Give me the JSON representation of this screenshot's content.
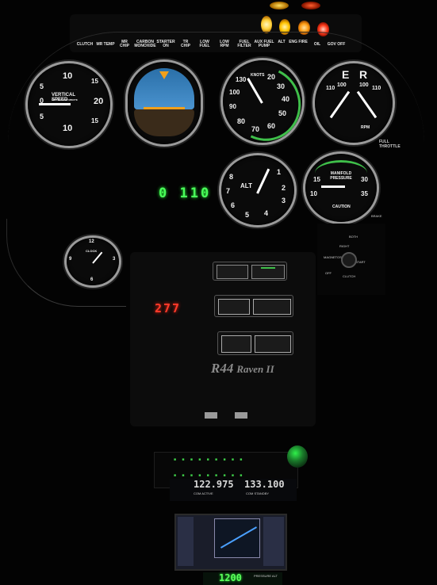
{
  "annunciators": [
    "CLUTCH",
    "MR TEMP",
    "MR CHIP",
    "CARBON MONOXIDE",
    "STARTER ON",
    "TR CHIP",
    "LOW FUEL",
    "LOW RPM",
    "FUEL FILTER",
    "AUX FUEL PUMP",
    "ALT",
    "ENG FIRE",
    "OIL",
    "GOV OFF"
  ],
  "gauges": {
    "vsi": {
      "title": "VERTICAL SPEED",
      "subtitle": "100 FEET PER MINUTE",
      "marks": [
        "10",
        "20",
        "10",
        "5",
        "5",
        "15",
        "15",
        "0"
      ]
    },
    "airspeed": {
      "title": "KNOTS",
      "marks": [
        "20",
        "30",
        "40",
        "50",
        "60",
        "70",
        "80",
        "90",
        "100",
        "130"
      ]
    },
    "tach": {
      "left_label": "E",
      "right_label": "R",
      "marks": [
        "110",
        "100",
        "100",
        "110"
      ],
      "unit": "RPM"
    },
    "altimeter": {
      "title": "ALT",
      "marks": [
        "8",
        "7",
        "6",
        "5",
        "4",
        "3",
        "2",
        "1"
      ]
    },
    "manifold": {
      "title": "MANIFOLD PRESSURE",
      "marks": [
        "15",
        "10",
        "30",
        "35"
      ],
      "caution": "CAUTION"
    },
    "clock": {
      "title": "CLOCK",
      "marks": [
        "12",
        "3",
        "6",
        "9"
      ]
    }
  },
  "readouts": {
    "green": "0 110",
    "red": "277",
    "bottom": "1200",
    "bottom_caption": "PRESSURE ALT"
  },
  "labels": {
    "full_throttle": "FULL THROTTLE",
    "model_main": "R44",
    "model_suffix": "Raven II"
  },
  "switches": [
    "BRAKE",
    "BOTH",
    "RIGHT",
    "MAGNETOS",
    "START",
    "OFF",
    "CLUTCH"
  ],
  "radio": {
    "active": "122.975",
    "active_caption": "COM ACTIVE",
    "standby": "133.100",
    "standby_caption": "COM STANDBY"
  }
}
